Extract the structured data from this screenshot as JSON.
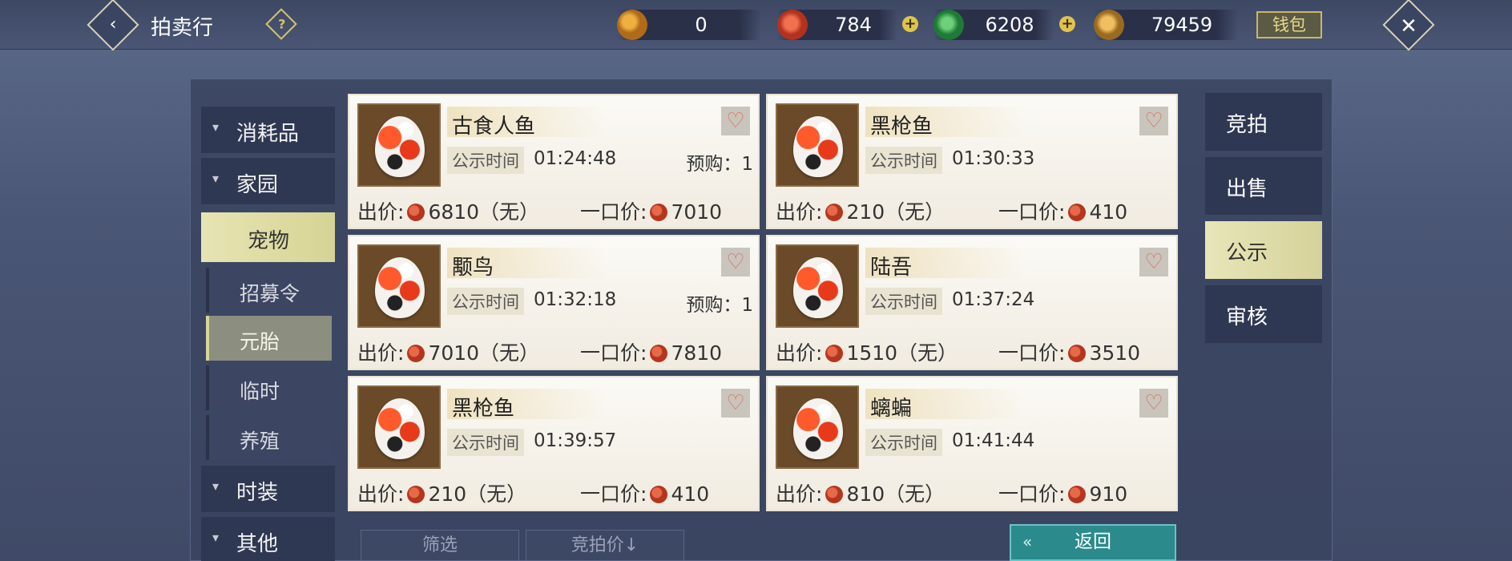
{
  "header": {
    "title": "拍卖行",
    "help_label": "?",
    "wallet_label": "钱包",
    "currencies": [
      {
        "icon": "gold-ingot-icon",
        "value": "0",
        "color": "#d48a2a"
      },
      {
        "icon": "red-coin-icon",
        "value": "784",
        "color": "#c9402a"
      },
      {
        "icon": "jade-coin-icon",
        "value": "6208",
        "color": "#2fa24a"
      },
      {
        "icon": "copper-coin-icon",
        "value": "79459",
        "color": "#c8962e"
      }
    ],
    "plus_label": "+"
  },
  "sidebar": {
    "categories": [
      {
        "label": "消耗品"
      },
      {
        "label": "家园"
      },
      {
        "label": "宠物"
      }
    ],
    "subcategories": [
      {
        "label": "招募令"
      },
      {
        "label": "元胎"
      },
      {
        "label": "临时"
      },
      {
        "label": "养殖"
      }
    ],
    "more_categories": [
      {
        "label": "时装"
      },
      {
        "label": "其他"
      }
    ]
  },
  "listings": [
    {
      "name": "古食人鱼",
      "pub_label": "公示时间",
      "pub_time": "01:24:48",
      "prebuy": "预购：1",
      "bid_label": "出价:",
      "bid": "6810（无）",
      "buyout_label": "一口价:",
      "buyout": "7010"
    },
    {
      "name": "黑枪鱼",
      "pub_label": "公示时间",
      "pub_time": "01:30:33",
      "prebuy": "",
      "bid_label": "出价:",
      "bid": "210（无）",
      "buyout_label": "一口价:",
      "buyout": "410"
    },
    {
      "name": "颙鸟",
      "pub_label": "公示时间",
      "pub_time": "01:32:18",
      "prebuy": "预购：1",
      "bid_label": "出价:",
      "bid": "7010（无）",
      "buyout_label": "一口价:",
      "buyout": "7810"
    },
    {
      "name": "陆吾",
      "pub_label": "公示时间",
      "pub_time": "01:37:24",
      "prebuy": "",
      "bid_label": "出价:",
      "bid": "1510（无）",
      "buyout_label": "一口价:",
      "buyout": "3510"
    },
    {
      "name": "黑枪鱼",
      "pub_label": "公示时间",
      "pub_time": "01:39:57",
      "prebuy": "",
      "bid_label": "出价:",
      "bid": "210（无）",
      "buyout_label": "一口价:",
      "buyout": "410"
    },
    {
      "name": "螭蝙",
      "pub_label": "公示时间",
      "pub_time": "01:41:44",
      "prebuy": "",
      "bid_label": "出价:",
      "bid": "810（无）",
      "buyout_label": "一口价:",
      "buyout": "910"
    }
  ],
  "tabs": [
    {
      "label": "竞拍"
    },
    {
      "label": "出售"
    },
    {
      "label": "公示"
    },
    {
      "label": "审核"
    }
  ],
  "footer": {
    "filter_label": "筛选",
    "sort_label": "竞拍价↓",
    "return_label": "返回"
  }
}
